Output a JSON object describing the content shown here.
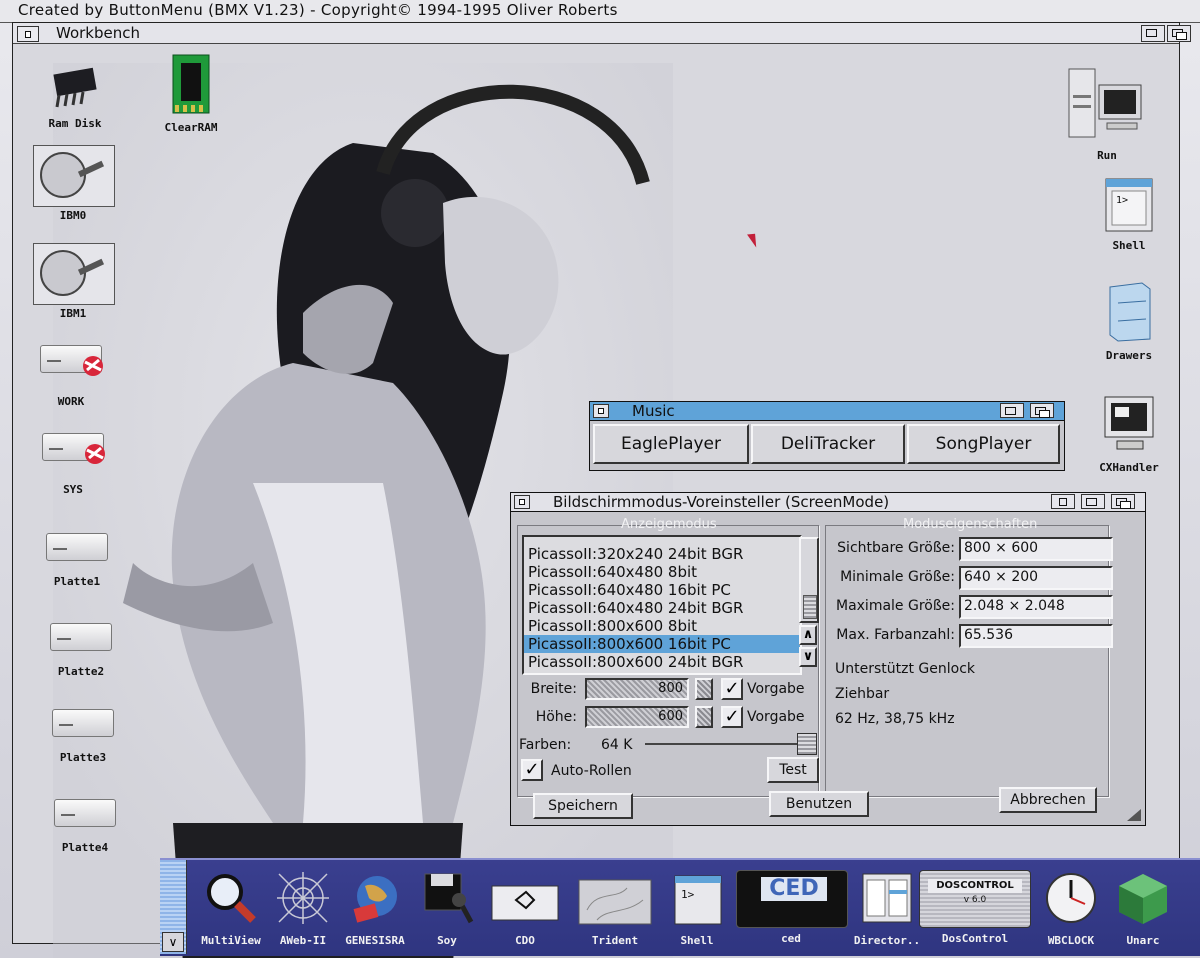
{
  "screen_title": "Created by ButtonMenu (BMX V1.23) - Copyright© 1994-1995 Oliver Roberts",
  "workbench": {
    "title": "Workbench"
  },
  "desktop_icons_left": [
    {
      "label": "Ram Disk",
      "icon": "chip-icon"
    },
    {
      "label": "ClearRAM",
      "icon": "memory-module-icon"
    },
    {
      "label": "IBM0",
      "icon": "hard-disk-icon"
    },
    {
      "label": "IBM1",
      "icon": "hard-disk-icon"
    },
    {
      "label": "WORK",
      "icon": "drive-icon"
    },
    {
      "label": "SYS",
      "icon": "drive-icon"
    },
    {
      "label": "Platte1",
      "icon": "drive-icon"
    },
    {
      "label": "Platte2",
      "icon": "drive-icon"
    },
    {
      "label": "Platte3",
      "icon": "drive-icon"
    },
    {
      "label": "Platte4",
      "icon": "drive-icon"
    }
  ],
  "desktop_icons_right": [
    {
      "label": "Run",
      "icon": "computer-icon"
    },
    {
      "label": "Shell",
      "icon": "shell-icon"
    },
    {
      "label": "Drawers",
      "icon": "cabinet-icon"
    },
    {
      "label": "CXHandler",
      "icon": "monitor-icon"
    }
  ],
  "music_window": {
    "title": "Music",
    "buttons": [
      "EaglePlayer",
      "DeliTracker",
      "SongPlayer"
    ]
  },
  "screenmode_window": {
    "title": "Bildschirmmodus-Voreinsteller (ScreenMode)",
    "group_mode": "Anzeigemodus",
    "group_props": "Moduseigenschaften",
    "modes": [
      "PicassoII:320x240 24bit BGR",
      "PicassoII:640x480  8bit",
      "PicassoII:640x480 16bit PC",
      "PicassoII:640x480 24bit BGR",
      "PicassoII:800x600  8bit",
      "PicassoII:800x600 16bit PC",
      "PicassoII:800x600 24bit BGR"
    ],
    "selected_mode": "PicassoII:800x600 16bit PC",
    "props": [
      {
        "label": "Sichtbare Größe:",
        "value": "800 × 600"
      },
      {
        "label": "Minimale Größe:",
        "value": "640 × 200"
      },
      {
        "label": "Maximale Größe:",
        "value": "2.048 × 2.048"
      },
      {
        "label": "Max. Farbanzahl:",
        "value": "65.536"
      }
    ],
    "info_lines": [
      "Unterstützt Genlock",
      "Ziehbar",
      "62 Hz, 38,75 kHz"
    ],
    "width_label": "Breite:",
    "width_value": "800",
    "height_label": "Höhe:",
    "height_value": "600",
    "default_label": "Vorgabe",
    "colors_label": "Farben:",
    "colors_value": "64 K",
    "colors_slider_fraction": 1.0,
    "autoscroll_label": "Auto-Rollen",
    "test_label": "Test",
    "save_label": "Speichern",
    "use_label": "Benutzen",
    "cancel_label": "Abbrechen"
  },
  "dock": [
    {
      "label": "MultiView",
      "icon": "magnifier-icon"
    },
    {
      "label": "AWeb-II",
      "icon": "web-icon"
    },
    {
      "label": "GENESISRA",
      "icon": "globe-icon"
    },
    {
      "label": "Sоy",
      "icon": "floppy-mic-icon"
    },
    {
      "label": "CDO",
      "icon": "cd-icon"
    },
    {
      "label": "Trident",
      "icon": "map-icon"
    },
    {
      "label": "Shell",
      "icon": "shell-icon"
    },
    {
      "label": "ced",
      "icon": "ced-icon"
    },
    {
      "label": "Director..",
      "icon": "director-icon"
    },
    {
      "label": "DosControl",
      "icon": "doscontrol-icon"
    },
    {
      "label": "WBCLOCK",
      "icon": "clock-icon"
    },
    {
      "label": "Unarc",
      "icon": "cube-icon"
    }
  ],
  "dock_panel_texts": {
    "ced_text": "CED",
    "dos_text": "DOSCONTROL",
    "dos_version": "v 6.0"
  },
  "colors": {
    "accent": "#5fa3d8",
    "dock": "#2f3580",
    "pointer": "#c2203a"
  }
}
